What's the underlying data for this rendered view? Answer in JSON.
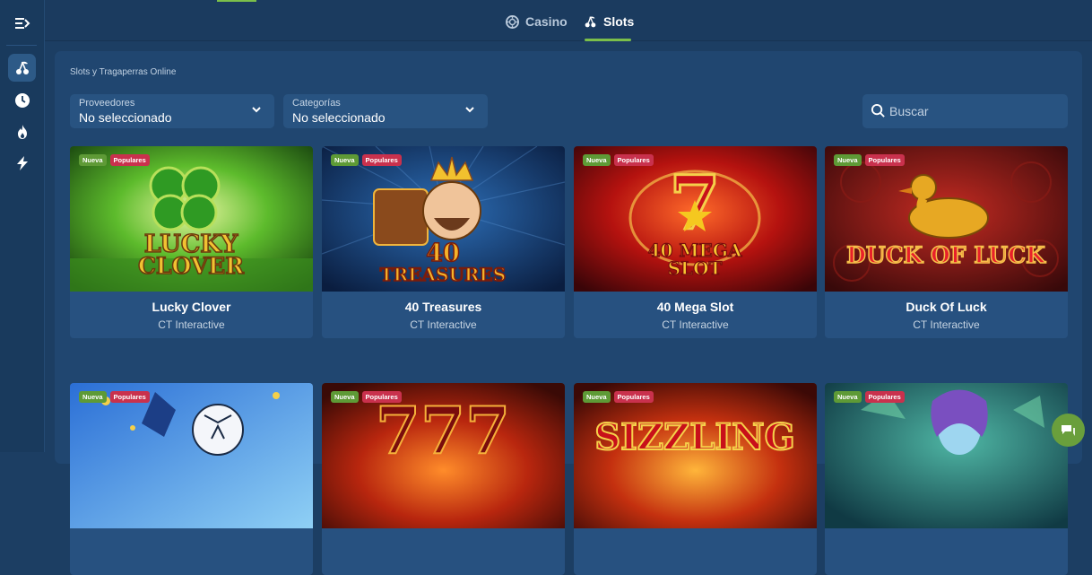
{
  "nav": {
    "tabs": [
      {
        "label": "Casino",
        "icon": "casino-chip-icon",
        "active": false
      },
      {
        "label": "Slots",
        "icon": "cherries-icon",
        "active": true
      }
    ]
  },
  "sidebar": {
    "items": [
      {
        "icon": "menu-arrow-icon"
      },
      {
        "icon": "cherries-icon",
        "active": true
      },
      {
        "icon": "clock-icon"
      },
      {
        "icon": "fire-icon"
      },
      {
        "icon": "lightning-icon"
      }
    ]
  },
  "page": {
    "title": "Slots y Tragaperras Online"
  },
  "filters": {
    "providers": {
      "label": "Proveedores",
      "value": "No seleccionado"
    },
    "categories": {
      "label": "Categorías",
      "value": "No seleccionado"
    },
    "search": {
      "placeholder": "Buscar"
    }
  },
  "badges": {
    "new": "Nueva",
    "popular": "Populares"
  },
  "games": [
    {
      "name": "Lucky Clover",
      "provider": "CT Interactive"
    },
    {
      "name": "40 Treasures",
      "provider": "CT Interactive"
    },
    {
      "name": "40 Mega Slot",
      "provider": "CT Interactive"
    },
    {
      "name": "Duck Of Luck",
      "provider": "CT Interactive"
    }
  ],
  "colors": {
    "accent": "#7bbf4a",
    "background": "#1c3e63",
    "panel": "#204670",
    "popular_badge": "#c9314d",
    "new_badge": "#5e9a36"
  }
}
